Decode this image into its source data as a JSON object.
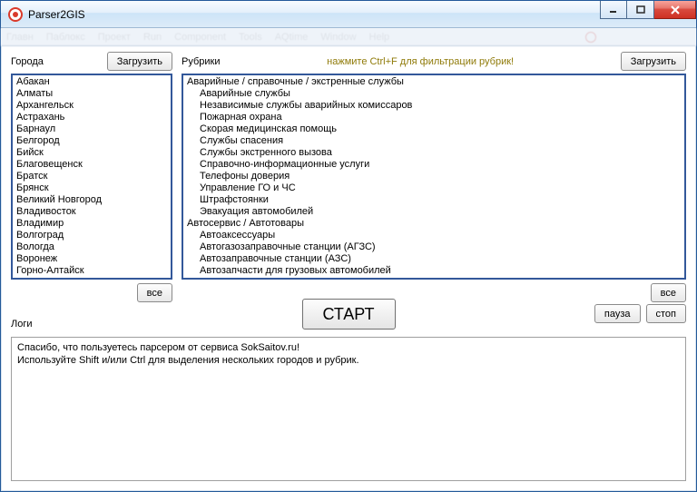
{
  "window": {
    "title": "Parser2GIS",
    "menu_blur": [
      "Главн",
      "Паблокс",
      "Проект",
      "Run",
      "Component",
      "Tools",
      "AQtime",
      "Window",
      "Help"
    ],
    "min_tip": "Свернуть",
    "max_tip": "Развернуть",
    "close_tip": "Закрыть"
  },
  "cities": {
    "label": "Города",
    "load_btn": "Загрузить",
    "all_btn": "все",
    "items": [
      "Абакан",
      "Алматы",
      "Архангельск",
      "Астрахань",
      "Барнаул",
      "Белгород",
      "Бийск",
      "Благовещенск",
      "Братск",
      "Брянск",
      "Великий Новгород",
      "Владивосток",
      "Владимир",
      "Волгоград",
      "Вологда",
      "Воронеж",
      "Горно-Алтайск"
    ]
  },
  "rubrics": {
    "label": "Рубрики",
    "hint": "нажмите Ctrl+F для фильтрации рубрик!",
    "load_btn": "Загрузить",
    "all_btn": "все",
    "items": [
      {
        "t": "Аварийные / справочные / экстренные службы",
        "i": 0
      },
      {
        "t": "Аварийные службы",
        "i": 1
      },
      {
        "t": "Независимые службы аварийных комиссаров",
        "i": 1
      },
      {
        "t": "Пожарная охрана",
        "i": 1
      },
      {
        "t": "Скорая медицинская помощь",
        "i": 1
      },
      {
        "t": "Службы спасения",
        "i": 1
      },
      {
        "t": "Службы экстренного вызова",
        "i": 1
      },
      {
        "t": "Справочно-информационные услуги",
        "i": 1
      },
      {
        "t": "Телефоны доверия",
        "i": 1
      },
      {
        "t": "Управление ГО и ЧС",
        "i": 1
      },
      {
        "t": "Штрафстоянки",
        "i": 1
      },
      {
        "t": "Эвакуация автомобилей",
        "i": 1
      },
      {
        "t": "Автосервис / Автотовары",
        "i": 0
      },
      {
        "t": "Автоаксессуары",
        "i": 1
      },
      {
        "t": "Автогазозаправочные станции (АГЗС)",
        "i": 1
      },
      {
        "t": "Автозаправочные станции (АЗС)",
        "i": 1
      },
      {
        "t": "Автозапчасти для грузовых автомобилей",
        "i": 1
      }
    ]
  },
  "actions": {
    "start": "СТАРТ",
    "pause": "пауза",
    "stop": "стоп",
    "logs_label": "Логи"
  },
  "logs": {
    "lines": [
      "Спасибо, что пользуетесь парсером от сервиса SokSaitov.ru!",
      "Используйте Shift и/или Ctrl для выделения нескольких городов и рубрик."
    ]
  }
}
